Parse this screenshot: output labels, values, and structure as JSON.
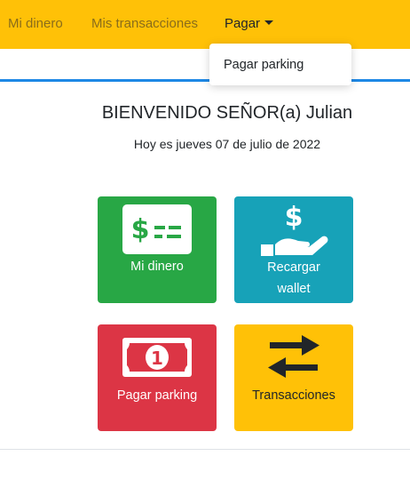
{
  "navbar": {
    "items": [
      {
        "label": "Mi dinero"
      },
      {
        "label": "Mis transacciones"
      },
      {
        "label": "Pagar"
      }
    ],
    "dropdown": {
      "items": [
        {
          "label": "Pagar parking"
        }
      ]
    }
  },
  "welcome": {
    "title": "BIENVENIDO SEÑOR(a) Julian",
    "date": "Hoy es jueves 07 de julio de 2022"
  },
  "tiles": [
    {
      "label": "Mi dinero",
      "icon": "money-bill-icon",
      "color": "#28a745"
    },
    {
      "label_line1": "Recargar",
      "label_line2": "wallet",
      "icon": "hand-dollar-icon",
      "color": "#17a2b8"
    },
    {
      "label": "Pagar parking",
      "icon": "banknote-icon",
      "color": "#dc3545"
    },
    {
      "label": "Transacciones",
      "icon": "exchange-arrows-icon",
      "color": "#ffc107"
    }
  ],
  "colors": {
    "navbar": "#ffc107",
    "accent_line": "#1e88e5"
  }
}
